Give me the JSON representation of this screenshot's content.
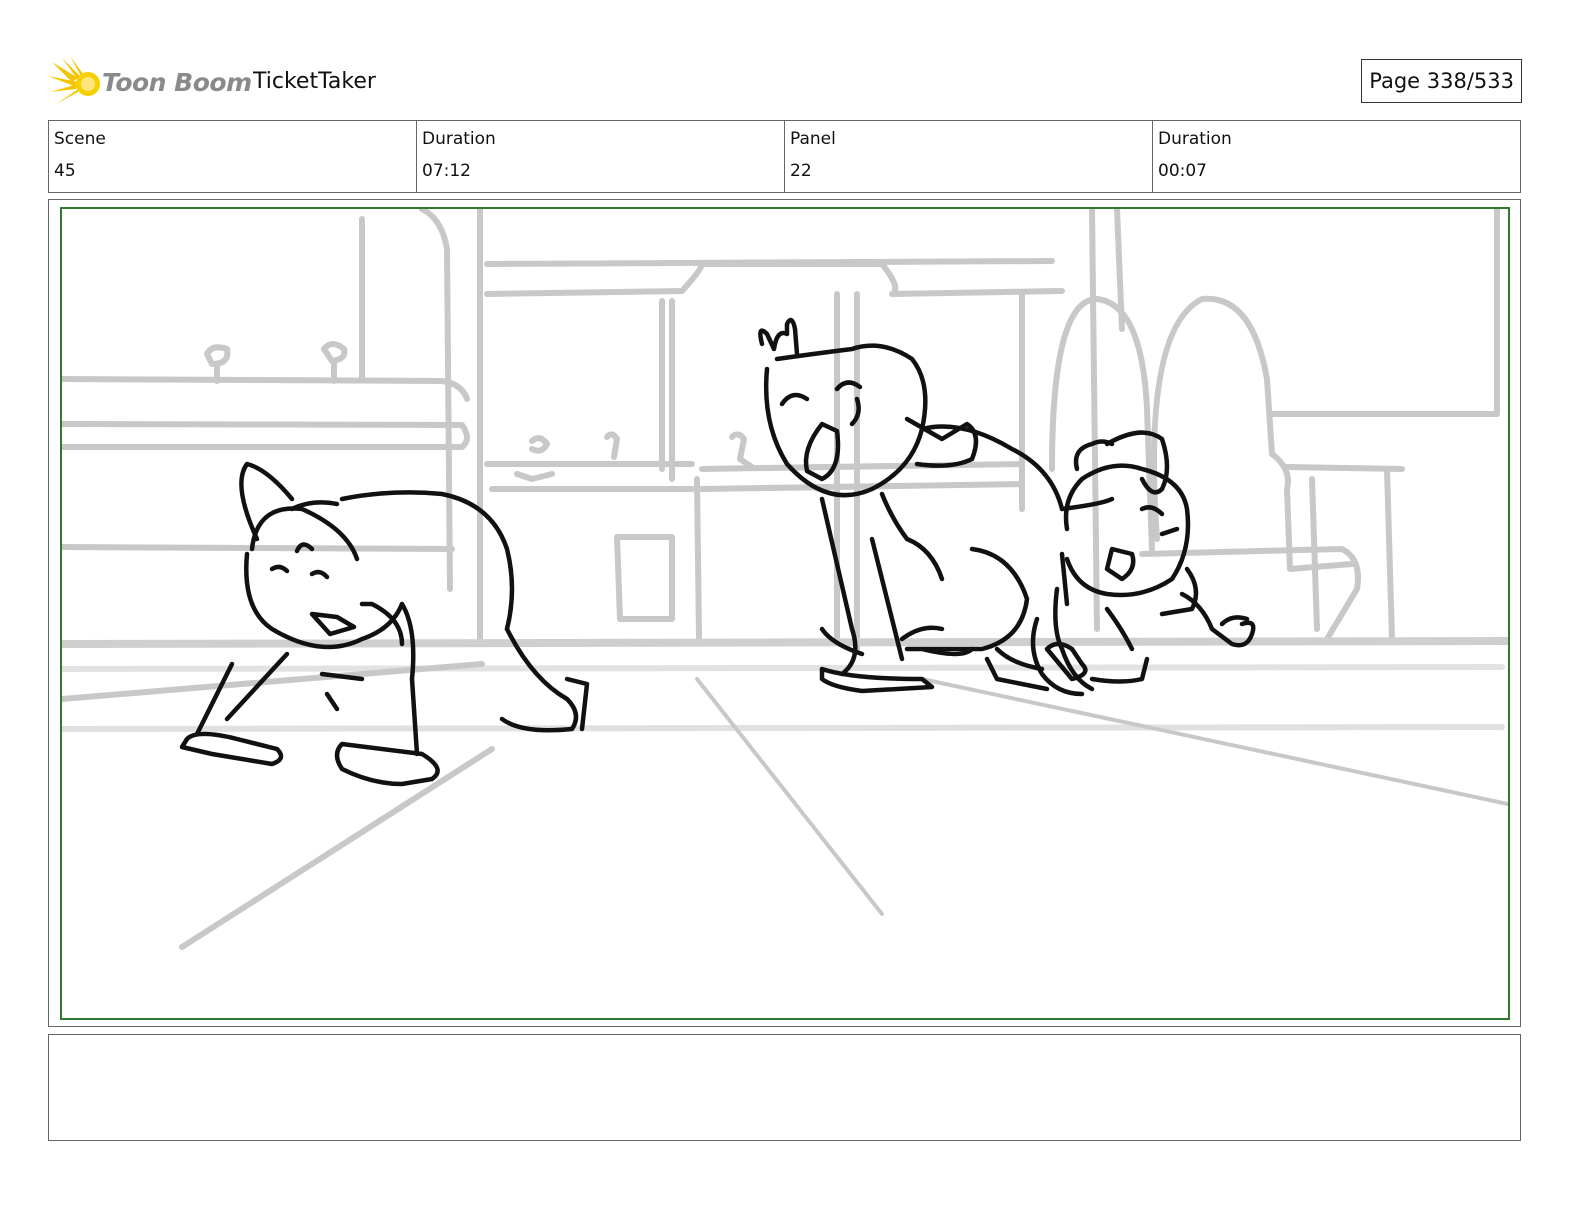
{
  "header": {
    "logo_text": "Toon Boom",
    "project_title": "TicketTaker",
    "page_indicator": "Page 338/533"
  },
  "info": {
    "scene_label": "Scene",
    "scene_value": "45",
    "scene_duration_label": "Duration",
    "scene_duration_value": "07:12",
    "panel_label": "Panel",
    "panel_value": "22",
    "panel_duration_label": "Duration",
    "panel_duration_value": "00:07"
  },
  "notes": {
    "text": ""
  },
  "colors": {
    "safe_frame": "#2f7a2f",
    "logo_burst": "#f5c400",
    "background_lines": "#c8c8c8",
    "character_lines": "#111111"
  }
}
